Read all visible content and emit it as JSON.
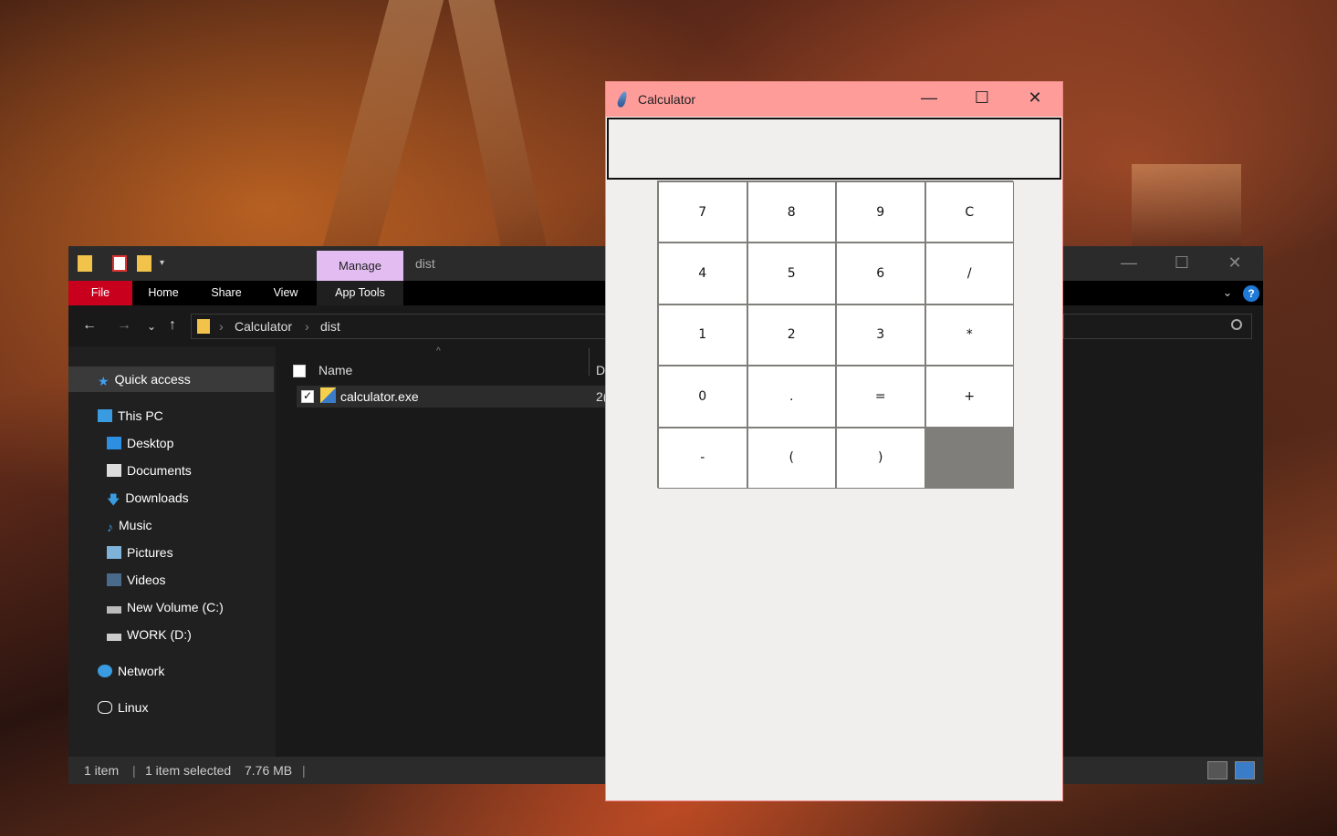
{
  "explorer": {
    "title": "dist",
    "manage_tab": "Manage",
    "ribbon_tabs": [
      "File",
      "Home",
      "Share",
      "View",
      "App Tools"
    ],
    "help_label": "?",
    "path": [
      "Calculator",
      "dist"
    ],
    "columns": {
      "name": "Name",
      "date": "D"
    },
    "nav": {
      "quick_access": "Quick access",
      "this_pc": "This PC",
      "items": [
        "Desktop",
        "Documents",
        "Downloads",
        "Music",
        "Pictures",
        "Videos",
        "New Volume (C:)",
        "WORK (D:)"
      ],
      "network": "Network",
      "linux": "Linux"
    },
    "files": [
      {
        "name": "calculator.exe",
        "date_partial": "2("
      }
    ],
    "status": {
      "count": "1 item",
      "selected": "1 item selected",
      "size": "7.76 MB"
    }
  },
  "calculator": {
    "title": "Calculator",
    "display_value": "",
    "keys": [
      "7",
      "8",
      "9",
      "C",
      "4",
      "5",
      "6",
      "/",
      "1",
      "2",
      "3",
      "*",
      "0",
      ".",
      "=",
      "+",
      "-",
      "(",
      ")",
      ""
    ]
  },
  "colors": {
    "calc_titlebar": "#fe9c9a",
    "manage_tab": "#e3bdf2",
    "file_tab": "#c8001e"
  }
}
